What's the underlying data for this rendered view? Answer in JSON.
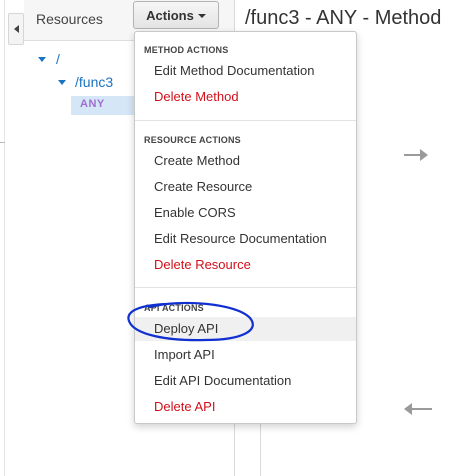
{
  "resources_panel": {
    "title": "Resources",
    "actions_label": "Actions",
    "tree": {
      "root": "/",
      "child": "/func3",
      "method": "ANY"
    }
  },
  "method_title": "/func3 - ANY - Method",
  "menu": {
    "method_actions": {
      "header": "METHOD ACTIONS",
      "items": [
        "Edit Method Documentation",
        "Delete Method"
      ]
    },
    "resource_actions": {
      "header": "RESOURCE ACTIONS",
      "items": [
        "Create Method",
        "Create Resource",
        "Enable CORS",
        "Edit Resource Documentation",
        "Delete Resource"
      ]
    },
    "api_actions": {
      "header": "API ACTIONS",
      "items": [
        "Deploy API",
        "Import API",
        "Edit API Documentation",
        "Delete API"
      ]
    }
  },
  "colors": {
    "link_blue": "#1a74c2",
    "danger_red": "#d0101b",
    "method_purple": "#9d6fd0",
    "annotation_ink": "#1030d0"
  },
  "icons": [
    "collapse-left-icon",
    "caret-down-icon",
    "arrow-right-icon",
    "arrow-left-icon"
  ]
}
